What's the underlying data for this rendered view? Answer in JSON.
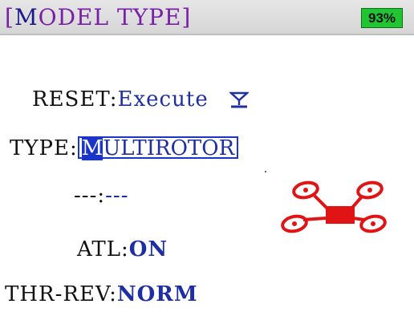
{
  "header": {
    "title_bracket_open": "[",
    "title_cursor_char": "M",
    "title_rest": "ODEL TYPE]",
    "battery_percent": "93%"
  },
  "rows": {
    "reset": {
      "label": "RESET:",
      "value": "Execute"
    },
    "type": {
      "label": "TYPE:",
      "value_first": "M",
      "value_rest": "ULTIROTOR"
    },
    "subtype": {
      "label": "---:",
      "value": "---"
    },
    "atl": {
      "label": "ATL:",
      "value": "ON"
    },
    "thr_rev": {
      "label": "THR-REV:",
      "value": "NORM"
    }
  },
  "icons": {
    "execute": "execute-arrow-icon",
    "model": "quadcopter-icon"
  },
  "colors": {
    "title": "#7a1fa8",
    "value": "#1e2fa3",
    "selection": "#1a35c8",
    "battery": "#21c431",
    "drone": "#e01414"
  }
}
